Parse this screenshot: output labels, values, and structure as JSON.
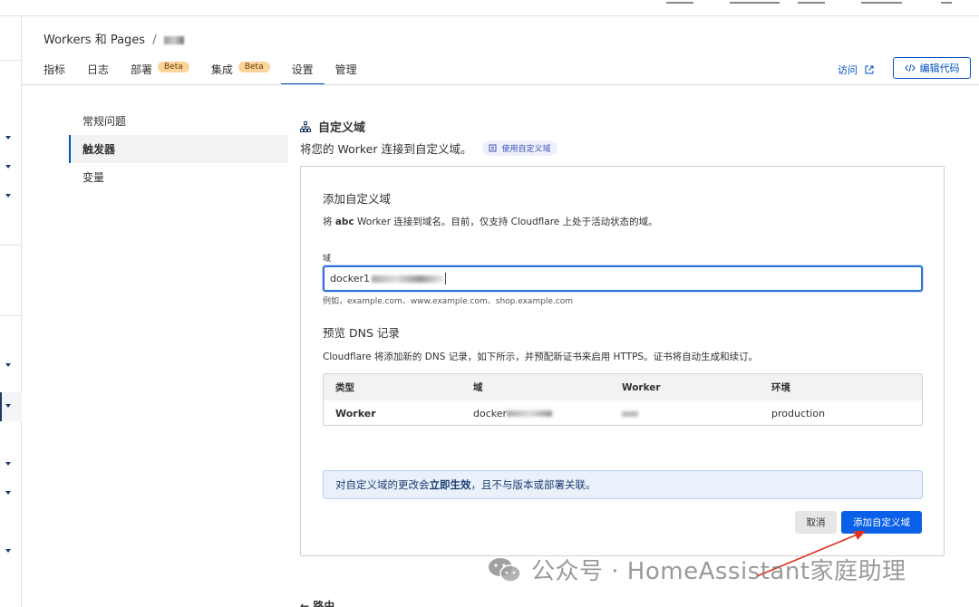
{
  "breadcrumb": {
    "root": "Workers 和 Pages",
    "separator": "/"
  },
  "tabs": [
    {
      "label": "指标"
    },
    {
      "label": "日志"
    },
    {
      "label": "部署",
      "badge": "Beta"
    },
    {
      "label": "集成",
      "badge": "Beta"
    },
    {
      "label": "设置",
      "active": true
    },
    {
      "label": "管理"
    }
  ],
  "header_actions": {
    "visit": "访问",
    "edit_code": "编辑代码"
  },
  "settings_menu": [
    {
      "label": "常规问题"
    },
    {
      "label": "触发器",
      "active": true
    },
    {
      "label": "变量"
    }
  ],
  "section": {
    "title": "自定义域",
    "description": "将您的 Worker 连接到自定义域。",
    "pill": "使用自定义域"
  },
  "card": {
    "title": "添加自定义域",
    "desc_prefix": "将",
    "desc_bold": "abc",
    "desc_suffix": "Worker 连接到域名。目前，仅支持 Cloudflare 上处于活动状态的域。",
    "field_label": "域",
    "field_value": "docker1",
    "hint": "例如，example.com、www.example.com、shop.example.com",
    "dns_title": "预览 DNS 记录",
    "dns_desc": "Cloudflare 将添加新的 DNS 记录，如下所示，并预配新证书来启用 HTTPS。证书将自动生成和续订。",
    "table": {
      "headers": [
        "类型",
        "域",
        "Worker",
        "环境"
      ],
      "row": {
        "type": "Worker",
        "domain": "docker",
        "worker": "",
        "env": "production"
      }
    },
    "notice_prefix": "对自定义域的更改会",
    "notice_bold": "立即生效",
    "notice_suffix": "，且不与版本或部署关联。",
    "cancel": "取消",
    "add": "添加自定义域"
  },
  "back_link": "← 路由",
  "watermark": "公众号 · HomeAssistant家庭助理",
  "colors": {
    "primary": "#0051c3",
    "button": "#0a60e6",
    "badge": "#fbd39b",
    "notice_bg": "#eaf1fb",
    "arrow": "#e0301e"
  }
}
